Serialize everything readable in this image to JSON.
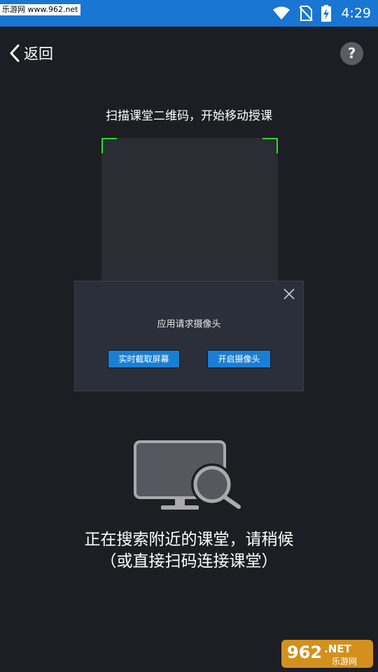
{
  "status_bar": {
    "watermark": "乐游网 www.962.net",
    "time": "4:29",
    "icons": [
      "wifi-icon",
      "no-sim-icon",
      "battery-charging-icon"
    ]
  },
  "nav": {
    "back_label": "返回",
    "help_label": "?"
  },
  "scan": {
    "hint": "扫描课堂二维码，开始移动授课"
  },
  "dialog": {
    "title": "应用请求摄像头",
    "screen_capture_button": "实时截取屏幕",
    "camera_button": "开启摄像头"
  },
  "search": {
    "status_line1": "正在搜索附近的课堂，请稍候",
    "status_line2": "（或直接扫码连接课堂）"
  },
  "watermark_bottom": {
    "number": "962",
    "suffix": ".NET",
    "name": "乐游网"
  },
  "colors": {
    "status_bar": "#1976d2",
    "background": "#1c1e23",
    "dialog": "#2b2f3a",
    "button": "#1a7fd4",
    "corner_accent": "#33d633"
  }
}
